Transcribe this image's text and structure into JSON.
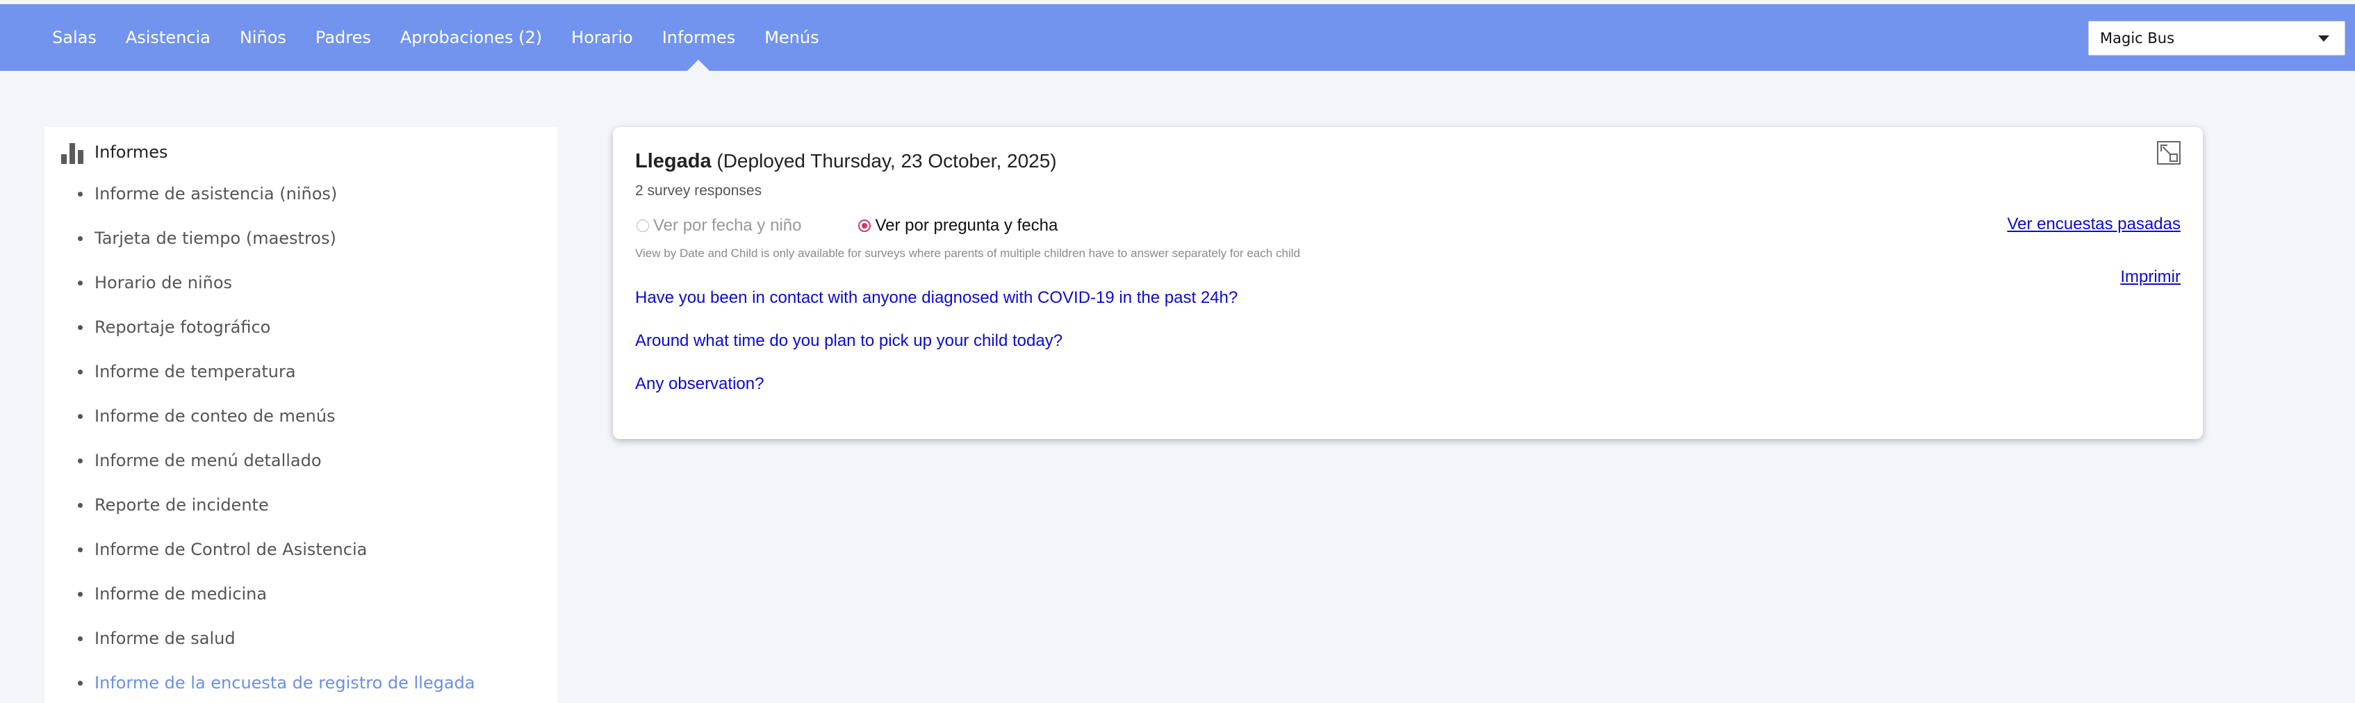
{
  "nav": {
    "items": [
      {
        "label": "Salas"
      },
      {
        "label": "Asistencia"
      },
      {
        "label": "Niños"
      },
      {
        "label": "Padres"
      },
      {
        "label": "Aprobaciones (2)"
      },
      {
        "label": "Horario"
      },
      {
        "label": "Informes",
        "active": true
      },
      {
        "label": "Menús"
      }
    ],
    "org_select": {
      "value": "Magic Bus"
    }
  },
  "sidebar": {
    "title": "Informes",
    "icon": "bar-chart-icon",
    "items": [
      {
        "label": "Informe de asistencia (niños)"
      },
      {
        "label": "Tarjeta de tiempo (maestros)"
      },
      {
        "label": "Horario de niños"
      },
      {
        "label": "Reportaje fotográfico"
      },
      {
        "label": "Informe de temperatura"
      },
      {
        "label": "Informe de conteo de menús"
      },
      {
        "label": "Informe de menú detallado"
      },
      {
        "label": "Reporte de incidente"
      },
      {
        "label": "Informe de Control de Asistencia"
      },
      {
        "label": "Informe de medicina"
      },
      {
        "label": "Informe de salud"
      },
      {
        "label": "Informe de la encuesta de registro de llegada",
        "active": true
      }
    ]
  },
  "survey": {
    "name": "Llegada",
    "deployed": "(Deployed Thursday, 23 October, 2025)",
    "responses": "2 survey responses",
    "view_by_date_child": "Ver por fecha y niño",
    "view_by_question_date": "Ver por pregunta y fecha",
    "selected_view": "Ver por pregunta y fecha",
    "note": "View by Date and Child is only available for surveys where parents of multiple children have to answer separately for each child",
    "past_surveys_link": "Ver encuestas pasadas",
    "print_link": "Imprimir",
    "questions": [
      "Have you been in contact with anyone diagnosed with COVID-19 in the past 24h?",
      "Around what time do you plan to pick up your child today?",
      "Any observation?"
    ]
  },
  "colors": {
    "navbar": "#7294ee",
    "link": "#0b0bd4",
    "active_sidebar": "#6a8fe8",
    "radio_selected": "#d6336c"
  }
}
